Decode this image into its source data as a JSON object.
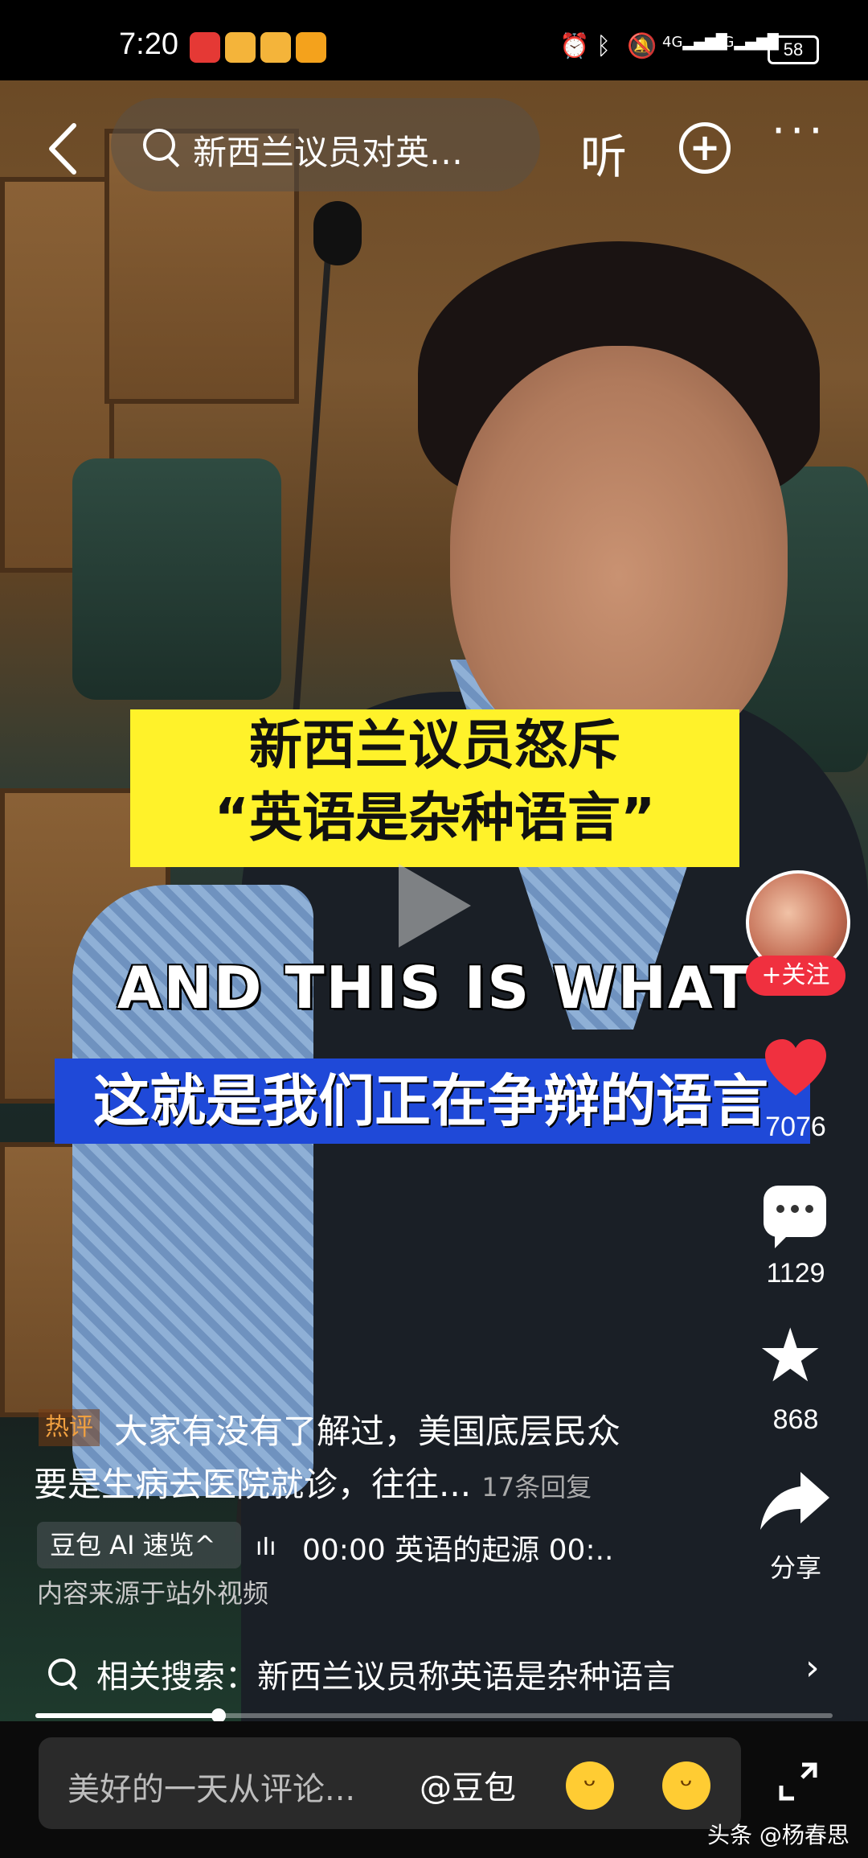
{
  "status_bar": {
    "time": "7:20",
    "battery": "58",
    "net1": "4G",
    "net2": "4G"
  },
  "top_nav": {
    "search_text": "新西兰议员对英…",
    "listen_label": "听"
  },
  "video": {
    "caption_yellow_line1": "新西兰议员怒斥",
    "caption_yellow_line2": "“英语是杂种语言”",
    "caption_english": "AND THIS IS WHAT",
    "caption_blue": "这就是我们正在争辩的语言"
  },
  "actions": {
    "follow_label": "+关注",
    "likes": "7076",
    "comments": "1129",
    "favorites": "868",
    "share_label": "分享"
  },
  "hot_comment": {
    "tag": "热评",
    "line1": "大家有没有了解过，美国底层民众",
    "line2": "要是生病去医院就诊，往往...",
    "replies": "17条回复"
  },
  "ai_summary": {
    "label": "豆包 AI 速览^",
    "time_text": "00:00 英语的起源    00:.."
  },
  "source_note": "内容来源于站外视频",
  "related_search": {
    "text": "相关搜索：新西兰议员称英语是杂种语言"
  },
  "progress": {
    "fraction": 0.23
  },
  "bottom_bar": {
    "placeholder": "美好的一天从评论...",
    "at_label": "@豆包"
  },
  "watermark": "头条 @杨春思",
  "colors": {
    "accent_red": "#f0303f",
    "caption_yellow": "#fff22a",
    "caption_blue": "#1f49d8"
  }
}
